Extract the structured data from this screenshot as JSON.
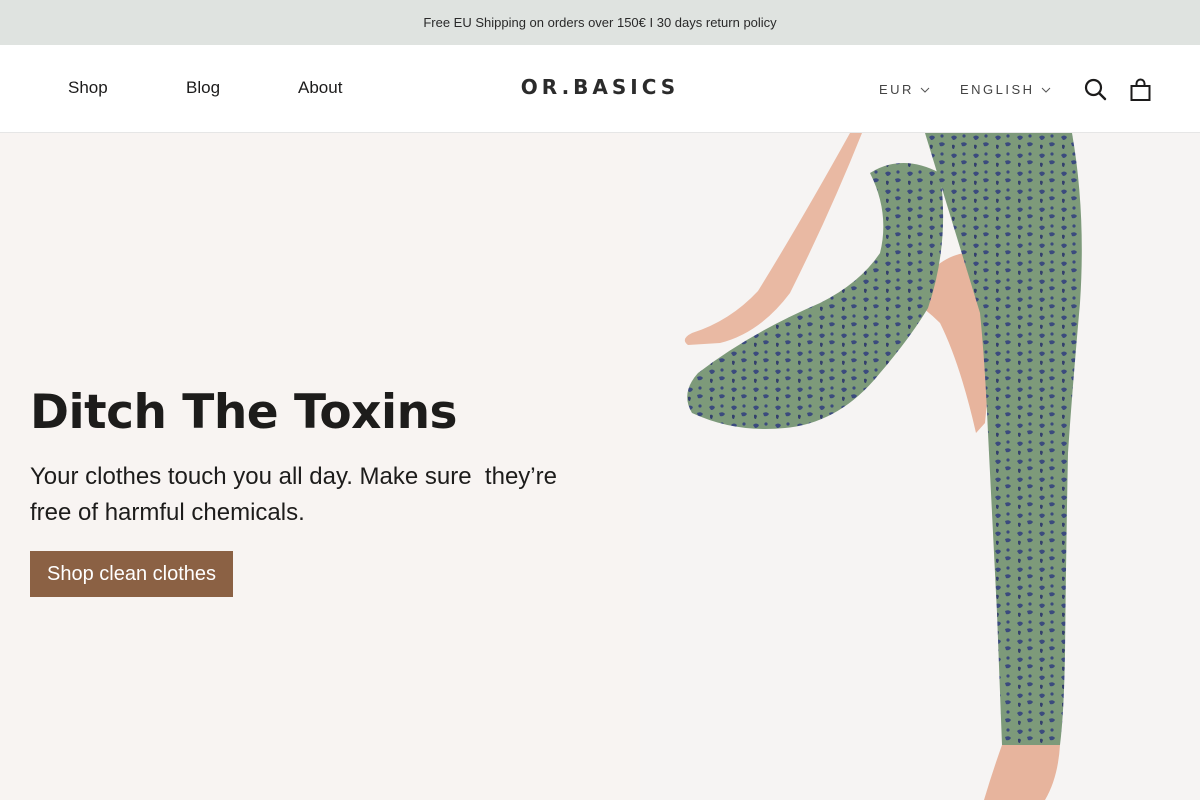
{
  "announcement": {
    "text": "Free EU Shipping on orders over 150€ I 30 days return policy"
  },
  "header": {
    "nav": [
      {
        "label": "Shop"
      },
      {
        "label": "Blog"
      },
      {
        "label": "About"
      }
    ],
    "logo": "OR.BASICS",
    "currency": "EUR",
    "language": "ENGLISH",
    "icons": {
      "search": "search-icon",
      "cart": "shopping-bag-icon",
      "dropdown": "chevron-down-icon"
    }
  },
  "hero": {
    "title": "Ditch The Toxins",
    "subtitle": "Your clothes touch you all day. Make sure  they’re free of harmful chemicals.",
    "cta_label": "Shop clean clothes",
    "image": "woman-in-leopard-print-leggings-yoga-pose"
  },
  "colors": {
    "announcement_bg": "#dfe3e0",
    "hero_bg": "#f8f4f2",
    "cta_bg": "#8b6144",
    "legging_green": "#7d9a7a",
    "legging_blue": "#3b4a7e"
  }
}
